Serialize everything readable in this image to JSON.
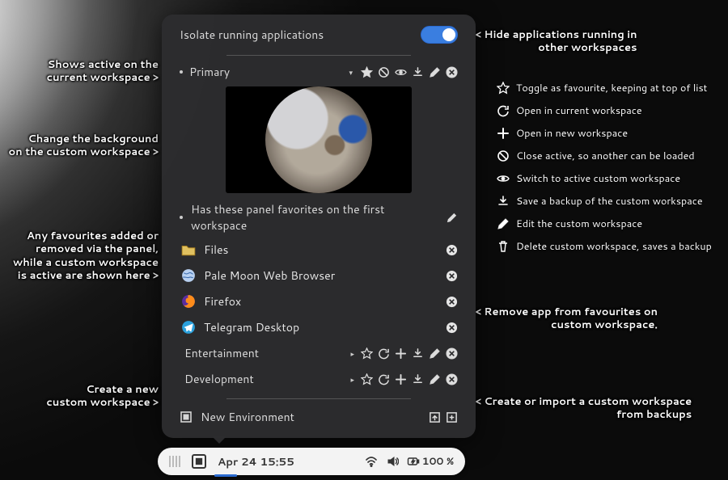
{
  "toggle": {
    "label": "Isolate running applications"
  },
  "workspace": {
    "name": "Primary"
  },
  "fav_header": "Has these panel favorites on the first workspace",
  "favorites": [
    {
      "label": "Files"
    },
    {
      "label": "Pale Moon Web Browser"
    },
    {
      "label": "Firefox"
    },
    {
      "label": "Telegram Desktop"
    }
  ],
  "groups": [
    {
      "label": "Entertainment"
    },
    {
      "label": "Development"
    }
  ],
  "newenv": {
    "label": "New Environment"
  },
  "legend": [
    "Toggle as favourite, keeping at top of list",
    "Open in current workspace",
    "Open in new workspace",
    "Close active, so another can be loaded",
    "Switch to active custom workspace",
    "Save a backup of the custom workspace",
    "Edit the custom workspace",
    "Delete custom workspace, saves a backup"
  ],
  "annotations": {
    "hide_apps": "< Hide applications running in\nother workspaces",
    "active_ws": "Shows active on the\ncurrent workspace >",
    "change_bg": "Change the background\non the custom workspace >",
    "favs_added": "Any favourites added or\nremoved via the panel,\nwhile a custom workspace\nis active are shown here >",
    "remove_fav": "< Remove app from favourites on\ncustom workspace.",
    "create_new": "Create a new\ncustom workspace >",
    "create_import": "< Create or import a custom workspace\nfrom backups"
  },
  "taskbar": {
    "clock": "Apr 24  15:55",
    "battery": "100 %"
  }
}
